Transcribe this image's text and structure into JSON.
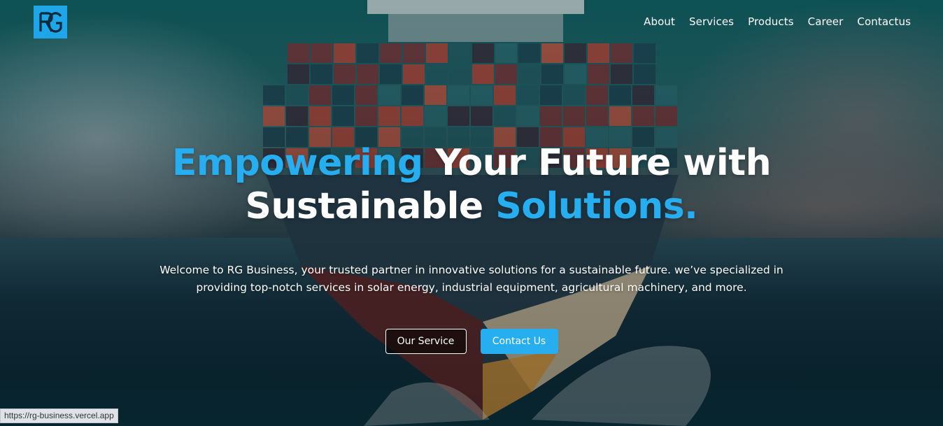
{
  "brand": {
    "logo_text": "RG",
    "logo_icon": "rg-logo-icon",
    "accent_color": "#27aef0"
  },
  "nav": {
    "items": [
      {
        "label": "About"
      },
      {
        "label": "Services"
      },
      {
        "label": "Products"
      },
      {
        "label": "Career"
      },
      {
        "label": "Contactus"
      }
    ]
  },
  "hero": {
    "headline": {
      "part1": "Empowering",
      "part2": " Your Future with",
      "part3": "Sustainable ",
      "part4": "Solutions."
    },
    "subtitle": "Welcome to RG Business, your trusted partner in innovative solutions for a sustainable future. we’ve specialized in providing top-notch services in solar energy, industrial equipment, agricultural machinery, and more.",
    "buttons": {
      "primary_outline": "Our Service",
      "primary_fill": "Contact Us"
    }
  },
  "status_bar": {
    "url": "https://rg-business.vercel.app"
  }
}
